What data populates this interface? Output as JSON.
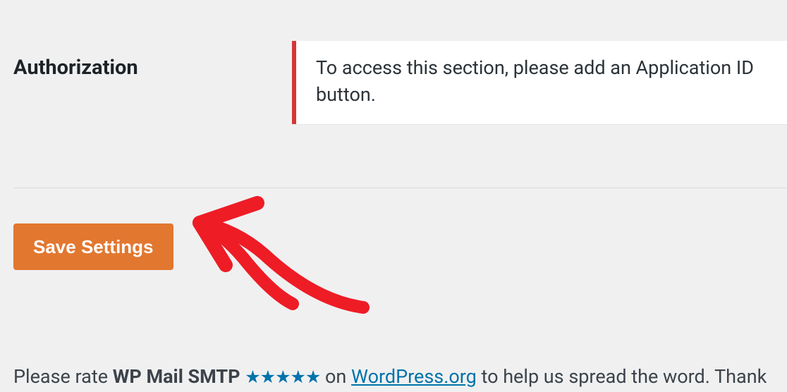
{
  "section": {
    "label": "Authorization",
    "notice": "To access this section, please add an Application ID button."
  },
  "actions": {
    "save_label": "Save Settings"
  },
  "footer": {
    "prefix": "Please rate ",
    "product": "WP Mail SMTP",
    "stars": "★★★★★",
    "mid": " on ",
    "link_text": "WordPress.org",
    "suffix": " to help us spread the word. Thank "
  }
}
